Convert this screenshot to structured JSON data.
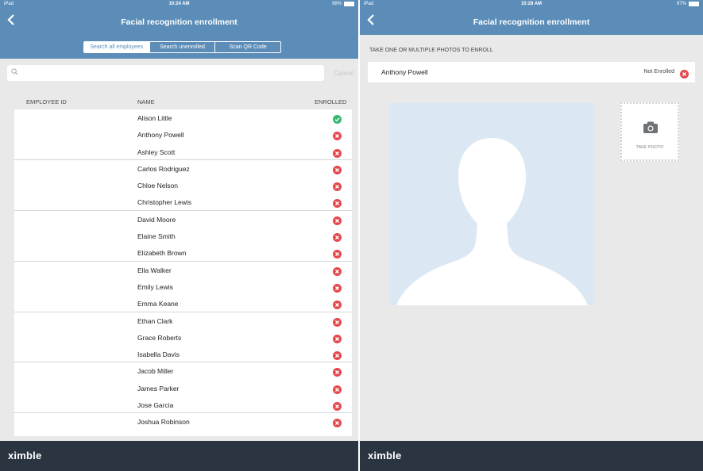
{
  "left": {
    "status": {
      "carrier": "iPad",
      "time": "10:24 AM",
      "battery": "98%",
      "battery_level": 0.98
    },
    "nav": {
      "title": "Facial recognition enrollment"
    },
    "segments": [
      "Search all employees",
      "Search unenrolled",
      "Scan QR Code"
    ],
    "search": {
      "placeholder": "",
      "cancel": "Cancel"
    },
    "columns": {
      "id": "EMPLOYEE ID",
      "name": "NAME",
      "enrolled": "ENROLLED"
    },
    "rows": [
      {
        "name": "Alison Little",
        "enrolled": true
      },
      {
        "name": "Anthony Powell",
        "enrolled": false
      },
      {
        "name": "Ashley Scott",
        "enrolled": false
      },
      {
        "name": "Carlos Rodriguez",
        "enrolled": false
      },
      {
        "name": "Chloe Nelson",
        "enrolled": false
      },
      {
        "name": "Christopher Lewis",
        "enrolled": false
      },
      {
        "name": "David Moore",
        "enrolled": false
      },
      {
        "name": "Elaine Smith",
        "enrolled": false
      },
      {
        "name": "Elizabeth Brown",
        "enrolled": false
      },
      {
        "name": "Ella Walker",
        "enrolled": false
      },
      {
        "name": "Emily Lewis",
        "enrolled": false
      },
      {
        "name": "Emma  Keane",
        "enrolled": false
      },
      {
        "name": "Ethan Clark",
        "enrolled": false
      },
      {
        "name": "Grace Roberts",
        "enrolled": false
      },
      {
        "name": "Isabella Davis",
        "enrolled": false
      },
      {
        "name": "Jacob Miller",
        "enrolled": false
      },
      {
        "name": "James Parker",
        "enrolled": false
      },
      {
        "name": "Jose Garcia",
        "enrolled": false
      },
      {
        "name": "Joshua Robinson",
        "enrolled": false
      },
      {
        "name": "",
        "enrolled": false
      }
    ],
    "brand": "ximble"
  },
  "right": {
    "status": {
      "carrier": "iPad",
      "time": "10:28 AM",
      "battery": "97%",
      "battery_level": 0.97
    },
    "nav": {
      "title": "Facial recognition enrollment"
    },
    "instruction": "TAKE ONE OR MULTIPLE PHOTOS TO ENROLL",
    "employee": {
      "name": "Anthony Powell",
      "status": "Not Enrolled"
    },
    "take_photo": "TAKE PHOTO",
    "brand": "ximble"
  },
  "colors": {
    "header": "#5b8db8",
    "footer": "#2b3542",
    "enrolled": "#34b86e",
    "not_enrolled": "#e5484d",
    "photo_bg": "#dbe8f3"
  },
  "icons": {
    "back": "chevron-left-icon",
    "search": "search-icon",
    "enrolled": "check-circle-icon",
    "not_enrolled": "x-circle-icon",
    "camera": "camera-icon"
  }
}
